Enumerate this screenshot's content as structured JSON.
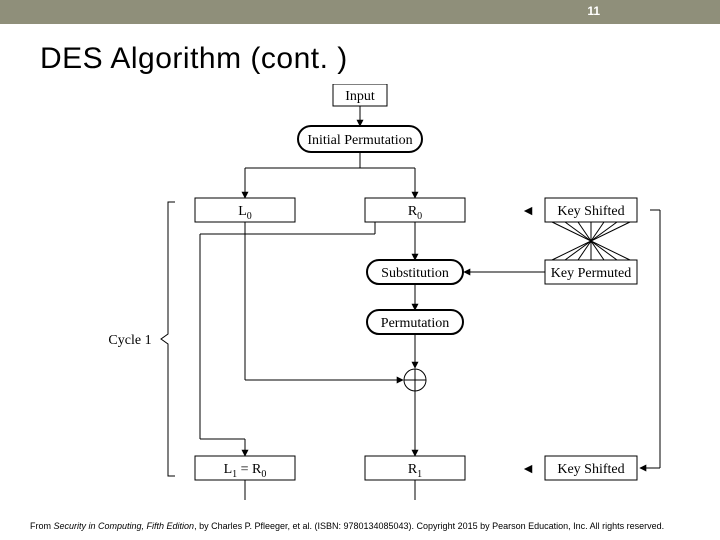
{
  "page_number": "11",
  "title": "DES Algorithm (cont. )",
  "diagram": {
    "input": "Input",
    "initial_perm": "Initial Permutation",
    "L0": "L",
    "L0_sub": "0",
    "R0": "R",
    "R0_sub": "0",
    "substitution": "Substitution",
    "permutation": "Permutation",
    "cycle": "Cycle 1",
    "L1": "L",
    "L1_sub": "1",
    "L1_eq": " = R",
    "L1_eq_sub": "0",
    "R1": "R",
    "R1_sub": "1",
    "key_shifted_top": "Key Shifted",
    "key_permuted": "Key Permuted",
    "key_shifted_bot": "Key Shifted",
    "arrow_left": "◄"
  },
  "footer_prefix": "From ",
  "footer_book": "Security in Computing, Fifth Edition",
  "footer_rest": ", by Charles P. Pfleeger, et al. (ISBN: 9780134085043). Copyright 2015 by Pearson Education, Inc. All rights reserved."
}
